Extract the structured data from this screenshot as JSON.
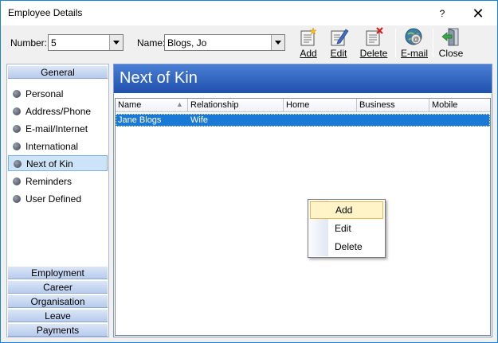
{
  "window": {
    "title": "Employee Details",
    "help_label": "?",
    "close_label": "✕"
  },
  "toolbar": {
    "number_label": "Number:",
    "number_value": "5",
    "name_label": "Name:",
    "name_value": "Blogs, Jo",
    "buttons": [
      {
        "label": "Add",
        "icon": "add-record-icon"
      },
      {
        "label": "Edit",
        "icon": "edit-record-icon"
      },
      {
        "label": "Delete",
        "icon": "delete-record-icon"
      },
      {
        "label": "E-mail",
        "icon": "email-globe-icon"
      },
      {
        "label": "Close",
        "icon": "exit-door-icon"
      }
    ]
  },
  "left_nav": {
    "general_header": "General",
    "items": [
      {
        "label": "Personal",
        "selected": false
      },
      {
        "label": "Address/Phone",
        "selected": false
      },
      {
        "label": "E-mail/Internet",
        "selected": false
      },
      {
        "label": "International",
        "selected": false
      },
      {
        "label": "Next of Kin",
        "selected": true
      },
      {
        "label": "Reminders",
        "selected": false
      },
      {
        "label": "User Defined",
        "selected": false
      }
    ],
    "sections": [
      "Employment",
      "Career",
      "Organisation",
      "Leave",
      "Payments"
    ]
  },
  "main": {
    "title": "Next of Kin",
    "columns": [
      "Name",
      "Relationship",
      "Home",
      "Business",
      "Mobile"
    ],
    "rows": [
      [
        "Jane Blogs",
        "Wife",
        "",
        "",
        ""
      ]
    ]
  },
  "context_menu": {
    "items": [
      {
        "label": "Add",
        "highlighted": true
      },
      {
        "label": "Edit",
        "highlighted": false
      },
      {
        "label": "Delete",
        "highlighted": false
      }
    ]
  },
  "colors": {
    "banner": "#2a5cbf",
    "selection": "#1a79d4",
    "menu_highlight": "#fff4c8"
  }
}
